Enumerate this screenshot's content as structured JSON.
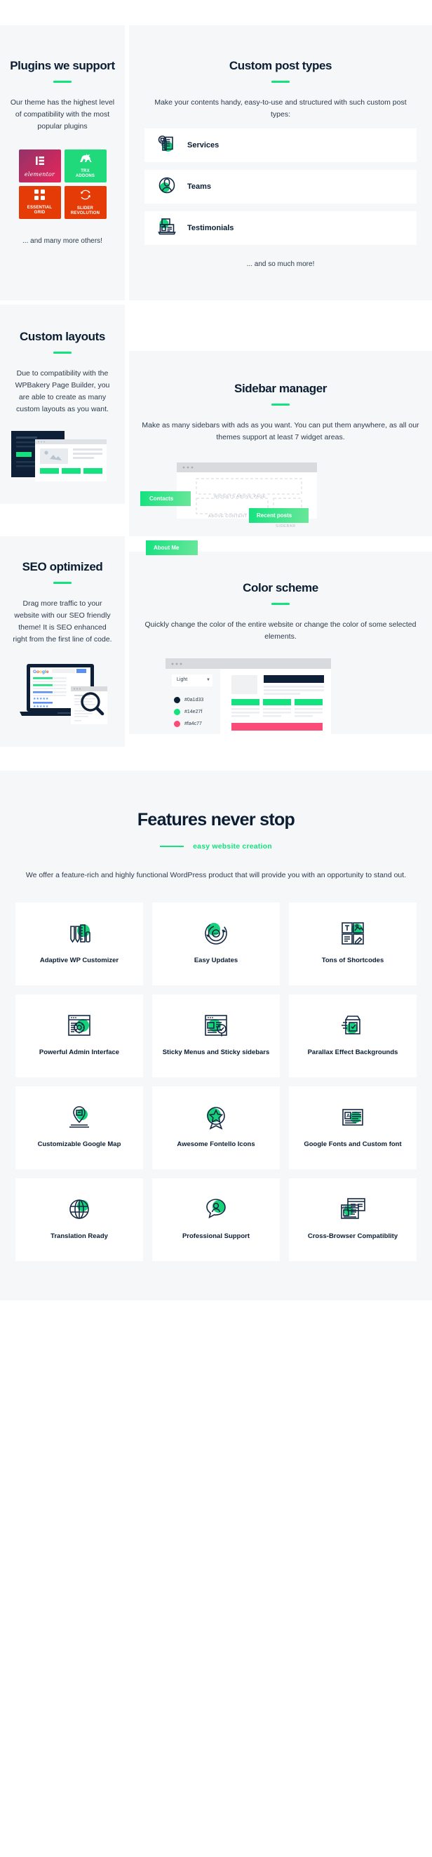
{
  "theme": {
    "dark": "#0a1d33",
    "green": "#14e27f",
    "pink": "#fa4c77",
    "panel_bg": "#f5f7f9",
    "card_bg": "#ffffff"
  },
  "plugins": {
    "title": "Plugins we support",
    "description": "Our theme has the highest level of compatibility with the most popular plugins",
    "footer": "... and many more others!",
    "logos": [
      {
        "name": "elementor",
        "line1": "elementor",
        "line2": "",
        "icon": "elementor-icon",
        "style": "elementor"
      },
      {
        "name": "trx-addons",
        "line1": "TRX",
        "line2": "ADDONS",
        "icon": "dino-icon",
        "style": "trx"
      },
      {
        "name": "essential-grid",
        "line1": "ESSENTIAL",
        "line2": "GRID",
        "icon": "grid-icon",
        "style": "essential"
      },
      {
        "name": "slider-revolution",
        "line1": "SLIDER",
        "line2": "REVOLUTION",
        "icon": "refresh-icon",
        "style": "slider"
      }
    ]
  },
  "post_types": {
    "title": "Custom post types",
    "description": "Make your contents handy, easy-to-use and structured with such custom post types:",
    "footer": "... and so much more!",
    "items": [
      {
        "label": "Services",
        "icon": "document-check-icon"
      },
      {
        "label": "Teams",
        "icon": "user-circle-icon"
      },
      {
        "label": "Testimonials",
        "icon": "laptop-review-icon"
      }
    ]
  },
  "layouts": {
    "title": "Custom layouts",
    "description": "Due to compatibility with the WPBakery Page Builder, you are able to create as many custom layouts as you want."
  },
  "sidebar_manager": {
    "title": "Sidebar manager",
    "description": "Make as many sidebars with ads as you want. You can put them anywhere, as all our themes support at least 7 widget areas.",
    "tags": [
      "Contacts",
      "Recent posts",
      "About Me"
    ],
    "zones": [
      "WIDGETS ABOVE PAGE",
      "ABOVE CONTENT",
      "SIDEBAR"
    ]
  },
  "seo": {
    "title": "SEO optimized",
    "description": "Drag more traffic to your website with our SEO friendly theme! It is SEO enhanced right from the first line of code.",
    "brand": "Google"
  },
  "color_scheme": {
    "title": "Color scheme",
    "description": "Quickly change the color of the entire website or change the color of some selected elements.",
    "select_value": "Light",
    "swatches": [
      {
        "hex": "#0a1d33",
        "label": "#0a1d33"
      },
      {
        "hex": "#14e27f",
        "label": "#14e27f"
      },
      {
        "hex": "#fa4c77",
        "label": "#fa4c77"
      }
    ]
  },
  "features": {
    "heading": "Features never stop",
    "subheading": "easy website creation",
    "lead": "We offer a feature-rich and highly functional WordPress product that will provide you with an opportunity to stand out.",
    "cards": [
      {
        "label": "Adaptive WP Customizer",
        "icon": "pencil-ruler-icon"
      },
      {
        "label": "Easy Updates",
        "icon": "refresh-circle-icon"
      },
      {
        "label": "Tons of Shortcodes",
        "icon": "layout-blocks-icon"
      },
      {
        "label": "Powerful Admin Interface",
        "icon": "browser-gear-icon"
      },
      {
        "label": "Sticky Menus and Sticky sidebars",
        "icon": "browser-check-icon"
      },
      {
        "label": "Parallax Effect Backgrounds",
        "icon": "open-box-icon"
      },
      {
        "label": "Customizable Google Map",
        "icon": "map-pin-icon"
      },
      {
        "label": "Awesome Fontello Icons",
        "icon": "star-badge-icon"
      },
      {
        "label": "Google Fonts and Custom font",
        "icon": "newspaper-icon"
      },
      {
        "label": "Translation Ready",
        "icon": "globe-icon"
      },
      {
        "label": "Professional Support",
        "icon": "support-chat-icon"
      },
      {
        "label": "Cross-Browser Compatiblity",
        "icon": "browsers-icon"
      }
    ]
  }
}
